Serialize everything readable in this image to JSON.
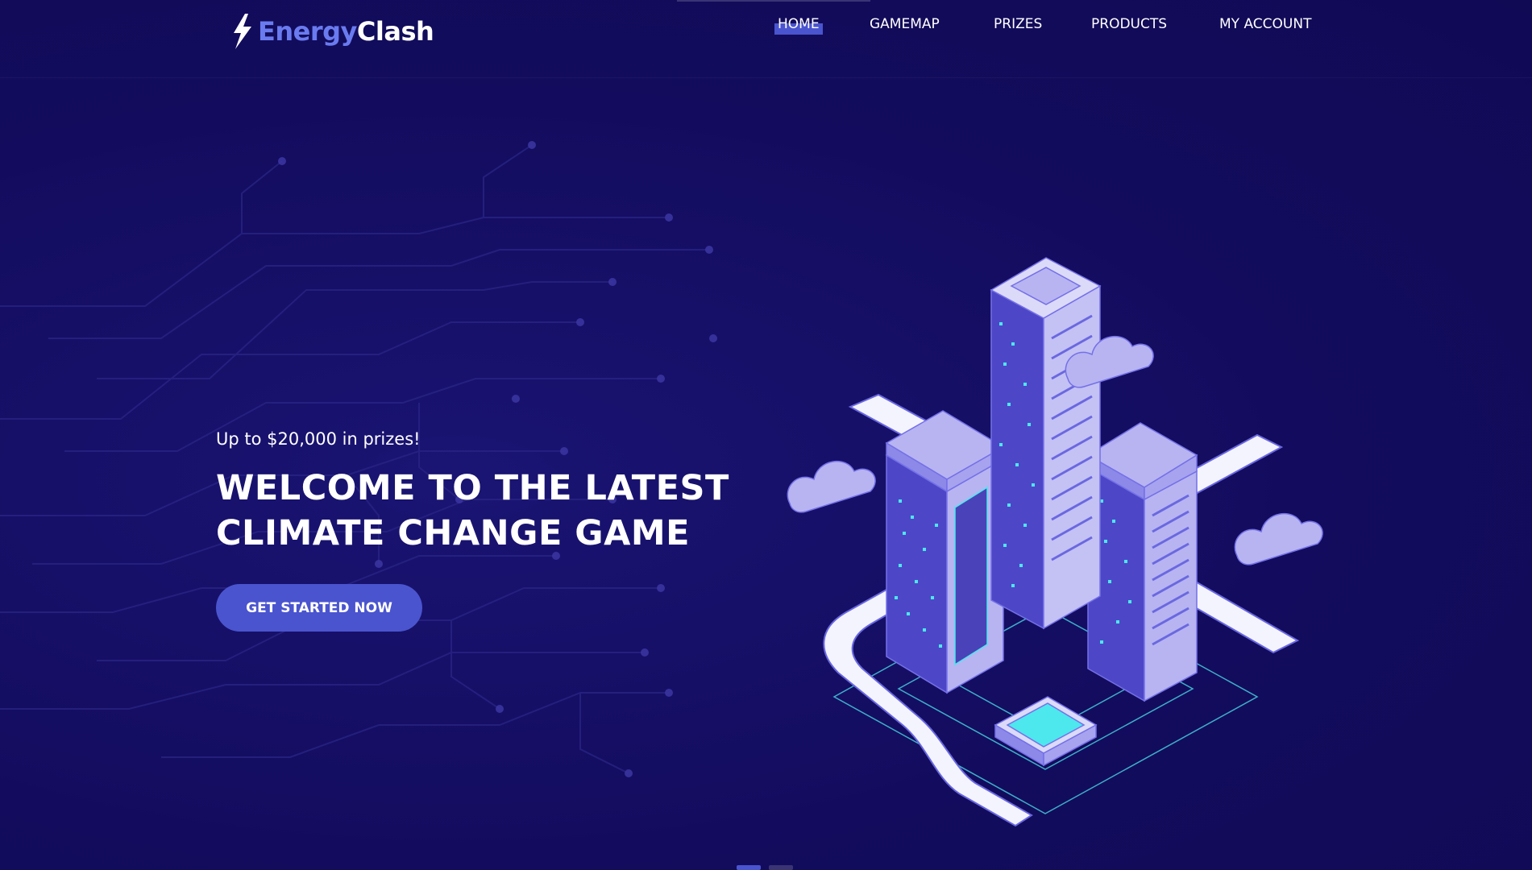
{
  "brand": {
    "part1": "Energy",
    "part2": "Clash",
    "accent": "#6a7bf0"
  },
  "nav": {
    "items": [
      {
        "label": "HOME",
        "active": true
      },
      {
        "label": "GAMEMAP",
        "active": false
      },
      {
        "label": "PRIZES",
        "active": false
      },
      {
        "label": "PRODUCTS",
        "active": false
      },
      {
        "label": "MY ACCOUNT",
        "active": false
      }
    ]
  },
  "hero": {
    "kicker": "Up to $20,000 in prizes!",
    "headline_line1": "WELCOME TO THE LATEST",
    "headline_line2": "CLIMATE CHANGE GAME",
    "cta_label": "GET STARTED NOW"
  },
  "slider": {
    "slides": 2,
    "active_index": 0
  },
  "colors": {
    "background": "#130c5e",
    "button": "#4a54cf",
    "building": "#b7b4f1",
    "glow": "#4de7ee"
  },
  "icons": {
    "logo": "lightning-bolt-icon"
  }
}
